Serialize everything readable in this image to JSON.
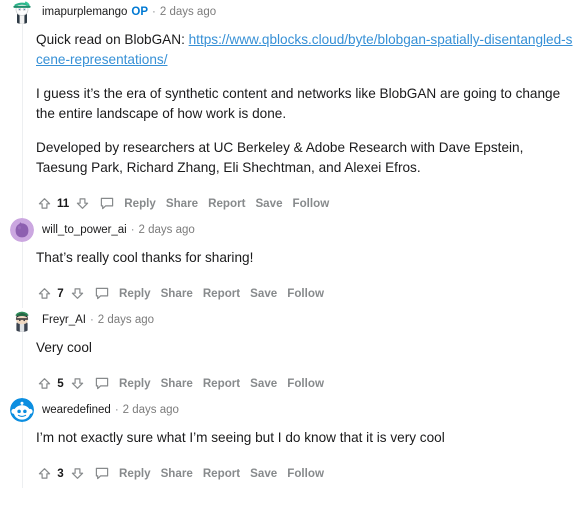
{
  "colors": {
    "link": "#3690d6",
    "op_badge": "#0079d3",
    "text": "#1a1a1b",
    "muted": "#878a8c",
    "thread_line": "#edeff1",
    "background": "#ffffff"
  },
  "action_labels": {
    "reply": "Reply",
    "share": "Share",
    "report": "Report",
    "save": "Save",
    "follow": "Follow"
  },
  "icons": {
    "upvote": "upvote-arrow-icon",
    "downvote": "downvote-arrow-icon",
    "comment": "comment-bubble-icon"
  },
  "comments": [
    {
      "username": "imapurplemango",
      "op_badge": "OP",
      "separator": "·",
      "timestamp": "2 days ago",
      "score": "11",
      "avatar": "snoo-teal-hat-avatar",
      "paragraphs": [
        {
          "prefix": "Quick read on BlobGAN: ",
          "link": "https://www.qblocks.cloud/byte/blobgan-spatially-disentangled-scene-representations/",
          "suffix": ""
        },
        {
          "text": "I guess it’s the era of synthetic content and networks like BlobGAN are going to change the entire landscape of how work is done."
        },
        {
          "text": "Developed by researchers at UC Berkeley & Adobe Research with Dave Epstein, Taesung Park, Richard Zhang, Eli Shechtman, and Alexei Efros."
        }
      ]
    },
    {
      "username": "will_to_power_ai",
      "op_badge": "",
      "separator": "·",
      "timestamp": "2 days ago",
      "score": "7",
      "avatar": "purple-blob-avatar",
      "paragraphs": [
        {
          "text": "That’s really cool thanks for sharing!"
        }
      ]
    },
    {
      "username": "Freyr_AI",
      "op_badge": "",
      "separator": "·",
      "timestamp": "2 days ago",
      "score": "5",
      "avatar": "dark-hair-green-hat-avatar",
      "paragraphs": [
        {
          "text": "Very cool"
        }
      ]
    },
    {
      "username": "wearedefined",
      "op_badge": "",
      "separator": "·",
      "timestamp": "2 days ago",
      "score": "3",
      "avatar": "snoo-blue-avatar",
      "paragraphs": [
        {
          "text": "I’m not exactly sure what I’m seeing but I do know that it is very cool"
        }
      ]
    }
  ]
}
